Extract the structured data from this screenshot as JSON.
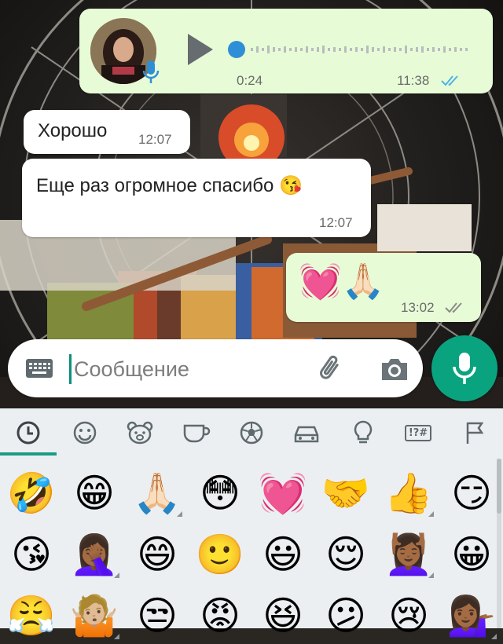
{
  "colors": {
    "outgoing_bubble": "#e7fcd6",
    "incoming_bubble": "#ffffff",
    "accent_green": "#0aa37f",
    "read_ticks": "#4fb3e6",
    "delivered_ticks": "#8a8a8a"
  },
  "messages": [
    {
      "kind": "voice",
      "direction": "outgoing",
      "duration": "0:24",
      "time": "11:38",
      "status": "read",
      "icon": "mic-icon"
    },
    {
      "kind": "text",
      "direction": "incoming",
      "text": "Хорошо",
      "time": "12:07"
    },
    {
      "kind": "text",
      "direction": "incoming",
      "text": "Еще раз огромное спасибо 😘",
      "time": "12:07"
    },
    {
      "kind": "emoji",
      "direction": "outgoing",
      "text": "💓🙏🏻",
      "time": "13:02",
      "status": "delivered"
    }
  ],
  "input": {
    "placeholder": "Сообщение",
    "keyboard_icon": "keyboard-icon",
    "attach_icon": "paperclip-icon",
    "camera_icon": "camera-icon",
    "send_icon": "mic-icon"
  },
  "emoji_keyboard": {
    "selected_category": "recent",
    "categories": [
      {
        "name": "recent",
        "icon": "clock-icon"
      },
      {
        "name": "smileys",
        "icon": "smiley-icon"
      },
      {
        "name": "animals",
        "icon": "bear-icon"
      },
      {
        "name": "food",
        "icon": "cup-icon"
      },
      {
        "name": "activity",
        "icon": "soccer-ball-icon"
      },
      {
        "name": "travel",
        "icon": "car-icon"
      },
      {
        "name": "objects",
        "icon": "lightbulb-icon"
      },
      {
        "name": "symbols",
        "label": "!?#"
      },
      {
        "name": "flags",
        "icon": "flag-icon"
      }
    ],
    "rows": [
      [
        "🤣",
        "😁",
        "🙏🏻",
        "😳",
        "💓",
        "🤝",
        "👍",
        "😏"
      ],
      [
        "😘",
        "🤦🏾‍♀️",
        "😄",
        "🙂",
        "😃",
        "😌",
        "💆🏾‍♀️",
        "😀"
      ],
      [
        "😤",
        "🤷🏼",
        "😒",
        "😡",
        "😆",
        "😕",
        "😢",
        "💁🏾‍♀️"
      ]
    ],
    "has_variants": [
      [
        false,
        false,
        true,
        false,
        false,
        false,
        true,
        false
      ],
      [
        false,
        true,
        false,
        false,
        false,
        false,
        true,
        false
      ],
      [
        false,
        true,
        false,
        false,
        false,
        false,
        false,
        true
      ]
    ]
  }
}
